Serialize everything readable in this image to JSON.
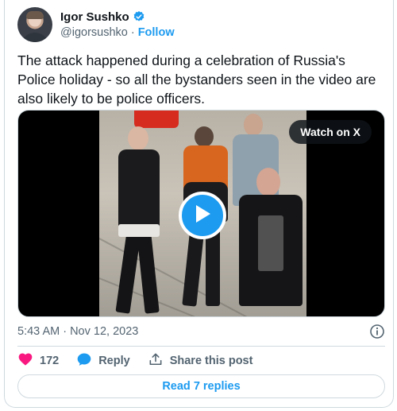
{
  "author": {
    "display_name": "Igor Sushko",
    "handle": "@igorsushko",
    "separator": "·",
    "follow_label": "Follow",
    "verified": true
  },
  "tweet": {
    "text": "The attack happened during a celebration of Russia's Police holiday - so all the bystanders seen in the video are also likely to be police officers.",
    "timestamp": "5:43 AM · Nov 12, 2023"
  },
  "media": {
    "watch_label": "Watch on X"
  },
  "actions": {
    "like_count": "172",
    "reply_label": "Reply",
    "share_label": "Share this post"
  },
  "footer": {
    "read_replies_label": "Read 7 replies"
  },
  "colors": {
    "accent": "#1d9bf0",
    "like": "#f91880",
    "muted_text": "#536471",
    "border": "#cfd9de"
  },
  "icons": [
    "verified-badge-icon",
    "play-icon",
    "info-icon",
    "heart-icon",
    "reply-bubble-icon",
    "share-icon"
  ]
}
